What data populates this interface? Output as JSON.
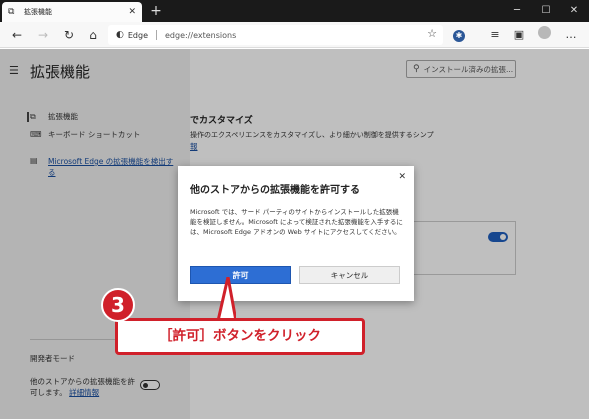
{
  "browser": {
    "tab_title": "拡張機能",
    "tab_close": "✕",
    "new_tab": "+",
    "window_controls": {
      "minimize": "─",
      "maximize": "☐",
      "close": "✕"
    },
    "address": {
      "site_label": "Edge",
      "url": "edge://extensions"
    }
  },
  "page": {
    "title": "拡張機能",
    "search_placeholder": "インストール済みの拡張...",
    "sidebar": {
      "items": [
        {
          "label": "拡張機能"
        },
        {
          "label": "キーボード ショートカット"
        }
      ],
      "store_link": "Microsoft Edge の拡張機能を検出する",
      "developer_mode": "開発者モード",
      "third_party_text": "他のストアからの拡張機能を許可します。",
      "third_party_link": "詳細情報"
    },
    "main": {
      "heading": "でカスタマイズ",
      "description": "操作のエクスペリエンスをカスタマイズし、より細かい制御を提供するシンプ",
      "link": "報"
    }
  },
  "dialog": {
    "title": "他のストアからの拡張機能を許可する",
    "body": "Microsoft では、サード パーティのサイトからインストールした拡張機能を検証しません。Microsoft によって検証された拡張機能を入手するには、Microsoft Edge アドオンの Web サイトにアクセスしてください。",
    "allow_label": "許可",
    "cancel_label": "キャンセル",
    "close": "✕"
  },
  "annotation": {
    "step": "3",
    "text": "［許可］ボタンをクリック"
  },
  "colors": {
    "accent": "#2d6ed4",
    "annotation_red": "#d0202a",
    "link": "#1a4fa0"
  }
}
